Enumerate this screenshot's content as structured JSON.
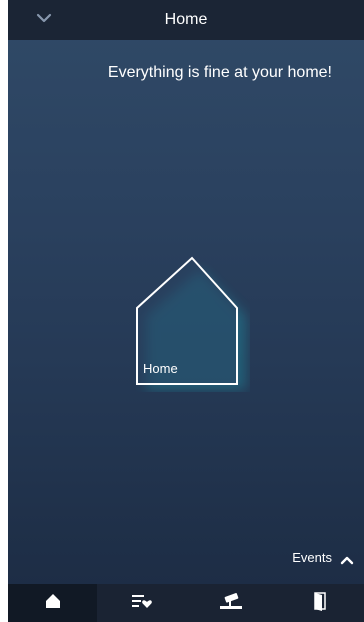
{
  "header": {
    "title": "Home",
    "collapse_icon": "chevron-down-icon"
  },
  "main": {
    "status_message": "Everything is fine at your home!",
    "house_label": "Home"
  },
  "events": {
    "label": "Events",
    "toggle_icon": "chevron-up-icon"
  },
  "tabs": [
    {
      "name": "home",
      "icon": "home-icon",
      "active": true
    },
    {
      "name": "favorites",
      "icon": "list-heart-icon",
      "active": false
    },
    {
      "name": "cameras",
      "icon": "camera-icon",
      "active": false
    },
    {
      "name": "doors",
      "icon": "door-icon",
      "active": false
    }
  ],
  "colors": {
    "accent_glow": "#1fb9c9",
    "bar": "#1b2535",
    "active_tab": "#111925"
  }
}
